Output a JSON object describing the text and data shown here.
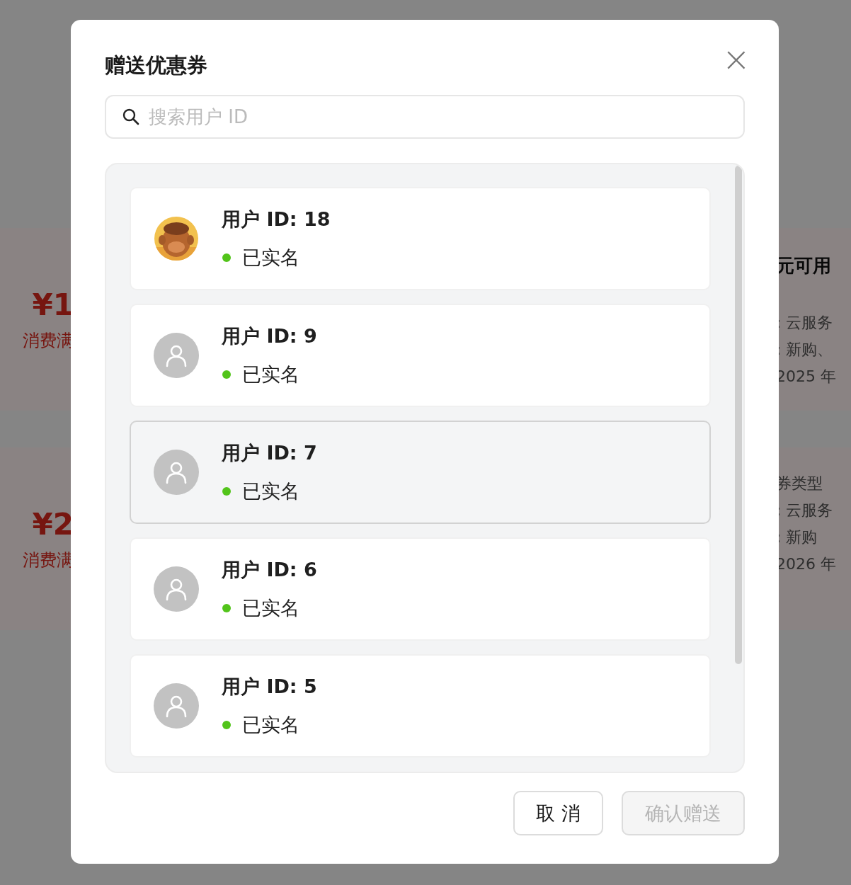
{
  "background": {
    "left_cards": [
      {
        "amount": "¥1",
        "condition": "消费满"
      },
      {
        "amount": "¥2",
        "condition": "消费满"
      }
    ],
    "right_cards": [
      {
        "lines": [
          {
            "text": "元可用",
            "kind": "title"
          },
          {
            "text": ": 云服务",
            "kind": "line"
          },
          {
            "text": ": 新购、",
            "kind": "line"
          },
          {
            "text": "2025 年",
            "kind": "line"
          }
        ]
      },
      {
        "lines": [
          {
            "text": "券类型",
            "kind": "line"
          },
          {
            "text": ": 云服务",
            "kind": "line"
          },
          {
            "text": ": 新购",
            "kind": "line"
          },
          {
            "text": "2026 年",
            "kind": "line"
          }
        ]
      }
    ]
  },
  "dialog": {
    "title": "赠送优惠券",
    "close": "×",
    "search": {
      "placeholder": "搜索用户 ID"
    },
    "users": [
      {
        "name": "用户 ID: 18",
        "status": "已实名",
        "verified": true,
        "kind": "picture",
        "selected": false
      },
      {
        "name": "用户 ID: 9",
        "status": "已实名",
        "verified": true,
        "kind": "default",
        "selected": false
      },
      {
        "name": "用户 ID: 7",
        "status": "已实名",
        "verified": true,
        "kind": "default",
        "selected": true
      },
      {
        "name": "用户 ID: 6",
        "status": "已实名",
        "verified": true,
        "kind": "default",
        "selected": false
      },
      {
        "name": "用户 ID: 5",
        "status": "已实名",
        "verified": true,
        "kind": "default",
        "selected": false
      }
    ],
    "buttons": [
      {
        "label": "取 消",
        "disabled": false
      },
      {
        "label": "确认赠送",
        "disabled": true
      }
    ]
  }
}
